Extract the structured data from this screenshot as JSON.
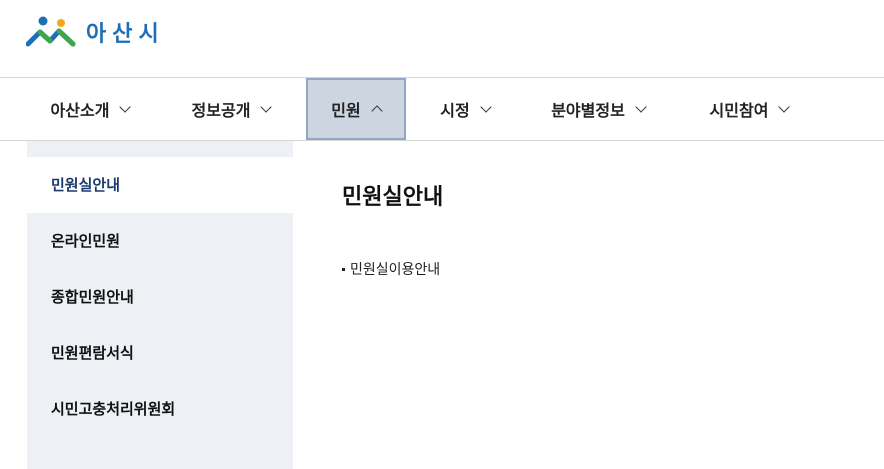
{
  "header": {
    "logo_text": "아산시"
  },
  "gnb": {
    "items": [
      {
        "label": "아산소개"
      },
      {
        "label": "정보공개"
      },
      {
        "label": "민원"
      },
      {
        "label": "시정"
      },
      {
        "label": "분야별정보"
      },
      {
        "label": "시민참여"
      }
    ],
    "active_index": 2
  },
  "lnb": {
    "items": [
      {
        "label": "민원실안내"
      },
      {
        "label": "온라인민원"
      },
      {
        "label": "종합민원안내"
      },
      {
        "label": "민원편람서식"
      },
      {
        "label": "시민고충처리위원회"
      }
    ],
    "active_index": 0
  },
  "content": {
    "title": "민원실안내",
    "links": [
      {
        "label": "민원실이용안내"
      }
    ]
  },
  "colors": {
    "logo_text": "#1f6fb5",
    "active_tab_bg": "#cdd5e0",
    "active_tab_border": "#8fa7c4",
    "lnb_bg": "#edf0f5",
    "lnb_active_text": "#1c3a6e"
  },
  "icons": {
    "logo": "asan-logo-icon",
    "dropdown": "chevron-down-icon",
    "dropdown_open": "chevron-up-icon"
  }
}
